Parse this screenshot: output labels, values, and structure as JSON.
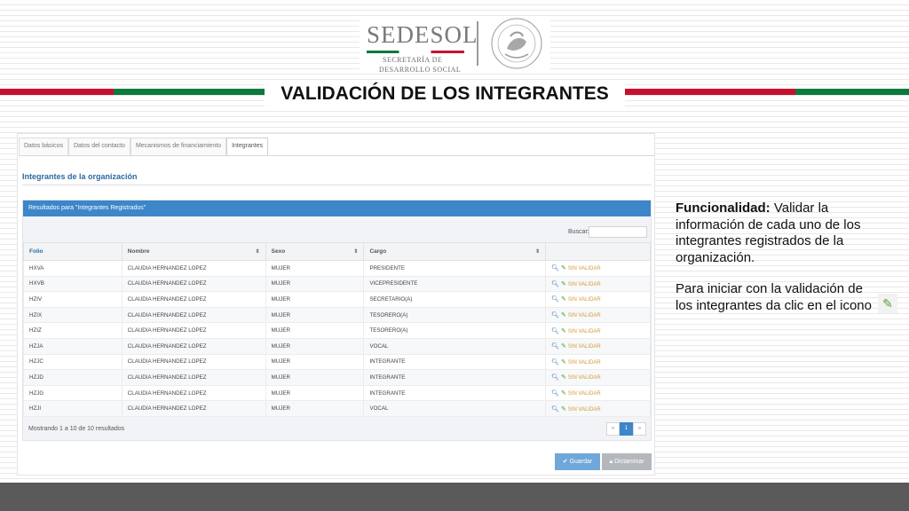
{
  "header": {
    "brand": "SEDESOL",
    "brand_sub1": "SECRETARÍA DE",
    "brand_sub2": "DESARROLLO SOCIAL",
    "seal_icon": "national-seal-icon",
    "slide_title": "VALIDACIÓN DE LOS INTEGRANTES",
    "colors": {
      "green": "#0b7a3e",
      "red": "#c8102e"
    }
  },
  "app": {
    "tabs": [
      {
        "label": "Datos básicos"
      },
      {
        "label": "Datos del contacto"
      },
      {
        "label": "Mecanismos de financiamiento"
      },
      {
        "label": "Integrantes"
      }
    ],
    "active_tab": "Integrantes",
    "section_title": "Integrantes de la organización",
    "results_header": "Resultados para \"Integrantes Registrados\"",
    "search_label": "Buscar:",
    "search_value": "",
    "columns": [
      "Folio",
      "Nombre",
      "Sexo",
      "Cargo",
      ""
    ],
    "rows": [
      {
        "folio": "HXVA",
        "nombre": "CLAUDIA HERNANDEZ LOPEZ",
        "sexo": "MUJER",
        "cargo": "PRESIDENTE",
        "status": "SIN VALIDAR"
      },
      {
        "folio": "HXVB",
        "nombre": "CLAUDIA HERNANDEZ LOPEZ",
        "sexo": "MUJER",
        "cargo": "VICEPRESIDENTE",
        "status": "SIN VALIDAR"
      },
      {
        "folio": "HZIV",
        "nombre": "CLAUDIA HERNANDEZ LOPEZ",
        "sexo": "MUJER",
        "cargo": "SECRETARIO(A)",
        "status": "SIN VALIDAR"
      },
      {
        "folio": "HZIX",
        "nombre": "CLAUDIA HERNANDEZ LOPEZ",
        "sexo": "MUJER",
        "cargo": "TESORERO(A)",
        "status": "SIN VALIDAR"
      },
      {
        "folio": "HZIZ",
        "nombre": "CLAUDIA HERNANDEZ LOPEZ",
        "sexo": "MUJER",
        "cargo": "TESORERO(A)",
        "status": "SIN VALIDAR"
      },
      {
        "folio": "HZJA",
        "nombre": "CLAUDIA HERNANDEZ LOPEZ",
        "sexo": "MUJER",
        "cargo": "VOCAL",
        "status": "SIN VALIDAR"
      },
      {
        "folio": "HZJC",
        "nombre": "CLAUDIA HERNANDEZ LOPEZ",
        "sexo": "MUJER",
        "cargo": "INTEGRANTE",
        "status": "SIN VALIDAR"
      },
      {
        "folio": "HZJD",
        "nombre": "CLAUDIA HERNANDEZ LOPEZ",
        "sexo": "MUJER",
        "cargo": "INTEGRANTE",
        "status": "SIN VALIDAR"
      },
      {
        "folio": "HZJG",
        "nombre": "CLAUDIA HERNANDEZ LOPEZ",
        "sexo": "MUJER",
        "cargo": "INTEGRANTE",
        "status": "SIN VALIDAR"
      },
      {
        "folio": "HZJI",
        "nombre": "CLAUDIA HERNANDEZ LOPEZ",
        "sexo": "MUJER",
        "cargo": "VOCAL",
        "status": "SIN VALIDAR"
      }
    ],
    "showing": "Mostrando 1 a 10 de 10 resultados",
    "pager": {
      "prev": "«",
      "current": "1",
      "next": "»"
    },
    "save_label": "Guardar",
    "dictaminar_label": "Dictaminar",
    "colors": {
      "primary": "#3c86c9",
      "status": "#d39c3a",
      "pencil": "#4c9a2a"
    }
  },
  "description": {
    "bold": "Funcionalidad:",
    "text1": " Validar la información de cada uno de los integrantes registrados de la organización.",
    "text2": "Para iniciar con la validación de los integrantes da clic en el icono"
  }
}
